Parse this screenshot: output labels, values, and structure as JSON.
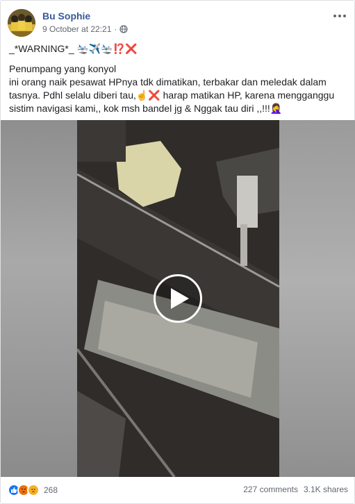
{
  "post": {
    "author": "Bu Sophie",
    "timestamp": "9 October at 22:21",
    "separator": "·",
    "privacy_icon": "globe-icon",
    "menu_icon": "more-horizontal-icon",
    "warning_line": "_*WARNING*_ 🛬✈️🛬⁉️❌",
    "body_line1": "Penumpang yang konyol",
    "body_line2": "ini orang naik pesawat HPnya tdk dimatikan, terbakar dan meledak dalam tasnya. Pdhl selalu diberi tau,☝️❌ harap matikan HP, karena mengganggu sistim navigasi kami,, kok msh bandel jg & Nggak tau diri ,,!!!🤦‍♀️"
  },
  "video": {
    "play_icon": "play-icon"
  },
  "footer": {
    "reaction_icons": [
      "like-icon",
      "angry-icon",
      "sad-icon"
    ],
    "reaction_count": "268",
    "comments": "227 comments",
    "shares": "3.1K shares"
  },
  "colors": {
    "author_link": "#385898",
    "meta_text": "#616770",
    "like_blue": "#1877f2",
    "angry_orange": "#e9710f",
    "sad_yellow": "#f7b125"
  }
}
